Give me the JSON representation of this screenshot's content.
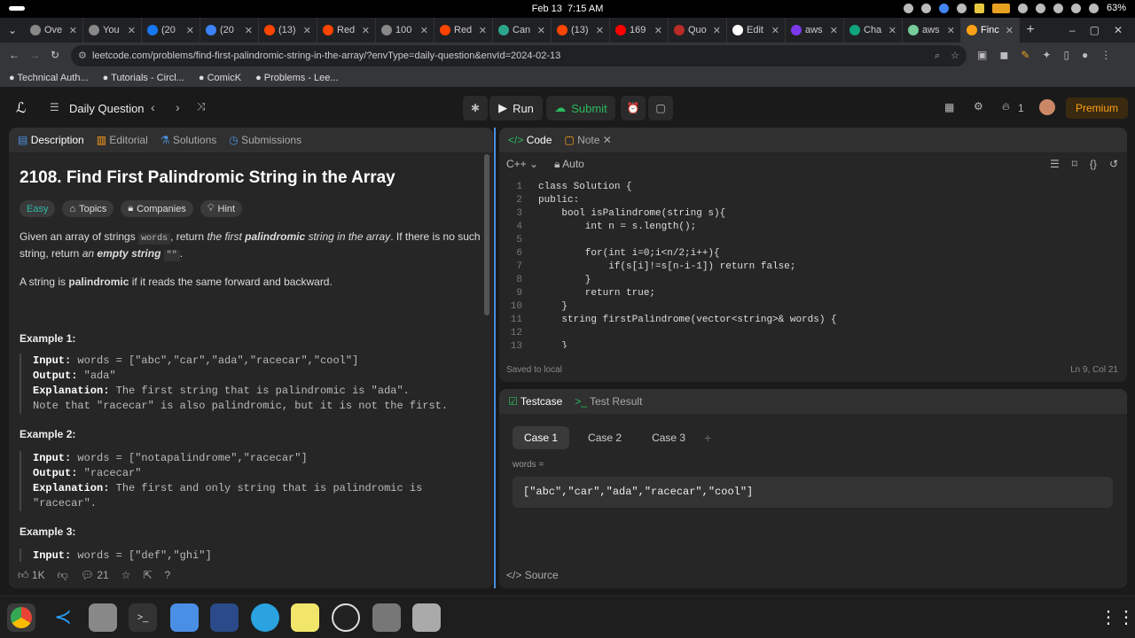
{
  "os": {
    "date": "Feb 13",
    "time": "7:15 AM",
    "battery": "63%"
  },
  "browser": {
    "tabs": [
      {
        "label": "Ove",
        "color": "#888"
      },
      {
        "label": "You",
        "color": "#888"
      },
      {
        "label": "(20",
        "color": "#1877f2"
      },
      {
        "label": "(20",
        "color": "#3b82f6"
      },
      {
        "label": "(13)",
        "color": "#ff4500"
      },
      {
        "label": "Red",
        "color": "#ff4500"
      },
      {
        "label": "100",
        "color": "#888"
      },
      {
        "label": "Red",
        "color": "#ff4500"
      },
      {
        "label": "Can",
        "color": "#2ca58d"
      },
      {
        "label": "(13)",
        "color": "#ff4500"
      },
      {
        "label": "169",
        "color": "#ff0000"
      },
      {
        "label": "Quo",
        "color": "#b92b27"
      },
      {
        "label": "Edit",
        "color": "#fff"
      },
      {
        "label": "aws",
        "color": "#7c3aed"
      },
      {
        "label": "Cha",
        "color": "#10a37f"
      },
      {
        "label": "aws",
        "color": "#7c9"
      },
      {
        "label": "Finc",
        "color": "#ffa116"
      }
    ],
    "url": "leetcode.com/problems/find-first-palindromic-string-in-the-array/?envType=daily-question&envId=2024-02-13",
    "bookmarks": [
      "Technical Auth...",
      "Tutorials - Circl...",
      "ComicK",
      "Problems - Lee..."
    ]
  },
  "nav": {
    "daily": "Daily Question",
    "run": "Run",
    "submit": "Submit",
    "streak": "1",
    "premium": "Premium"
  },
  "left": {
    "tabs": [
      "Description",
      "Editorial",
      "Solutions",
      "Submissions"
    ],
    "title": "2108. Find First Palindromic String in the Array",
    "chips": [
      "Easy",
      "Topics",
      "Companies",
      "Hint"
    ],
    "p1a": "Given an array of strings ",
    "p1code": "words",
    "p1b": ", return ",
    "p1i": "the first ",
    "p1bi": "palindromic",
    "p1c": " string in the array",
    ". If there is no such": "",
    "p1d": ". If there is no such string, return ",
    "p1e": "an ",
    "p1f": "empty string",
    "p1g": " ",
    "p1code2": "\"\"",
    "p1h": ".",
    "p2a": "A string is ",
    "p2b": "palindromic",
    "p2c": " if it reads the same forward and backward.",
    "ex1": {
      "head": "Example 1:",
      "in_l": "Input:",
      "in": " words = [\"abc\",\"car\",\"ada\",\"racecar\",\"cool\"]",
      "out_l": "Output:",
      "out": " \"ada\"",
      "exp_l": "Explanation:",
      "exp": " The first string that is palindromic is \"ada\".",
      "exp2": "Note that \"racecar\" is also palindromic, but it is not the first."
    },
    "ex2": {
      "head": "Example 2:",
      "in_l": "Input:",
      "in": " words = [\"notapalindrome\",\"racecar\"]",
      "out_l": "Output:",
      "out": " \"racecar\"",
      "exp_l": "Explanation:",
      "exp": " The first and only string that is palindromic is",
      "exp2": "\"racecar\"."
    },
    "ex3": {
      "head": "Example 3:",
      "in_l": "Input:",
      "in": " words = [\"def\",\"ghi\"]"
    },
    "likes": "1K",
    "comments": "21"
  },
  "code": {
    "tabs": [
      "Code",
      "Note"
    ],
    "lang": "C++",
    "mode": "Auto",
    "saved": "Saved to local",
    "pos": "Ln 9, Col 21",
    "lines": [
      "class Solution {",
      "public:",
      "    bool isPalindrome(string s){",
      "        int n = s.length();",
      "",
      "        for(int i=0;i<n/2;i++){",
      "            if(s[i]!=s[n-i-1]) return false;",
      "        }",
      "        return true;",
      "    }",
      "    string firstPalindrome(vector<string>& words) {",
      "",
      "    }"
    ]
  },
  "test": {
    "tabs": [
      "Testcase",
      "Test Result"
    ],
    "cases": [
      "Case 1",
      "Case 2",
      "Case 3"
    ],
    "var": "words =",
    "value": "[\"abc\",\"car\",\"ada\",\"racecar\",\"cool\"]",
    "source": "Source"
  }
}
